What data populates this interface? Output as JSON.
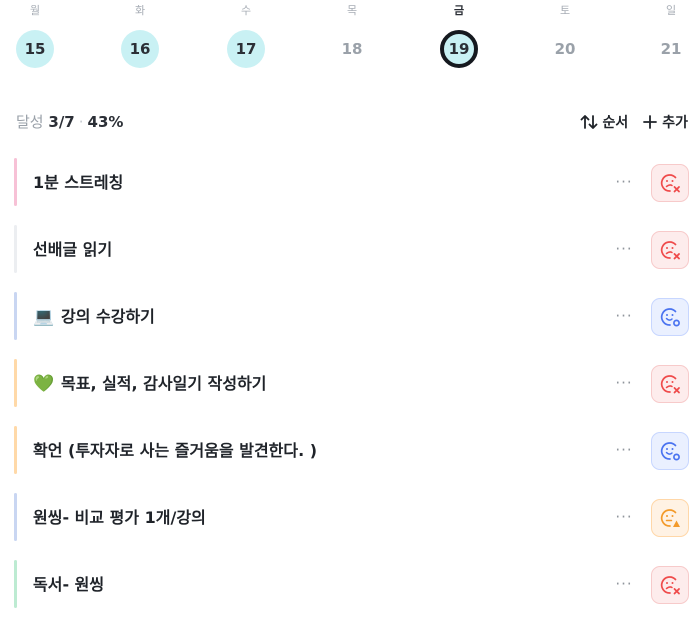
{
  "week": [
    {
      "dow": "월",
      "date": "15",
      "state": "done"
    },
    {
      "dow": "화",
      "date": "16",
      "state": "done"
    },
    {
      "dow": "수",
      "date": "17",
      "state": "done"
    },
    {
      "dow": "목",
      "date": "18",
      "state": "plain"
    },
    {
      "dow": "금",
      "date": "19",
      "state": "today"
    },
    {
      "dow": "토",
      "date": "20",
      "state": "plain"
    },
    {
      "dow": "일",
      "date": "21",
      "state": "plain"
    }
  ],
  "summary": {
    "prefix": "달성",
    "count": "3/7",
    "separator": "·",
    "percent": "43%"
  },
  "tools": {
    "order_label": "순서",
    "add_label": "추가"
  },
  "tasks": [
    {
      "label": "1분 스트레칭",
      "emoji": "",
      "bar": "#f7c1d6",
      "status": "fail"
    },
    {
      "label": "선배글 읽기",
      "emoji": "",
      "bar": "#eceef1",
      "status": "fail"
    },
    {
      "label": "강의 수강하기",
      "emoji": "💻",
      "bar": "#c9d6f2",
      "status": "ok"
    },
    {
      "label": "목표, 실적, 감사일기 작성하기",
      "emoji": "💚",
      "bar": "#ffd9a8",
      "status": "fail"
    },
    {
      "label": "확언 (투자자로 사는 즐거움을 발견한다. )",
      "emoji": "",
      "bar": "#ffd9a8",
      "status": "ok"
    },
    {
      "label": "원씽- 비교 평가 1개/강의",
      "emoji": "",
      "bar": "#c9d6f2",
      "status": "warn"
    },
    {
      "label": "독서- 원씽",
      "emoji": "",
      "bar": "#bdebd2",
      "status": "fail"
    }
  ],
  "more_label": "···",
  "colors": {
    "fail": "#ef4b4b",
    "ok": "#4a73f0",
    "warn": "#f39a2a",
    "accent_done": "#c9f1f4"
  }
}
